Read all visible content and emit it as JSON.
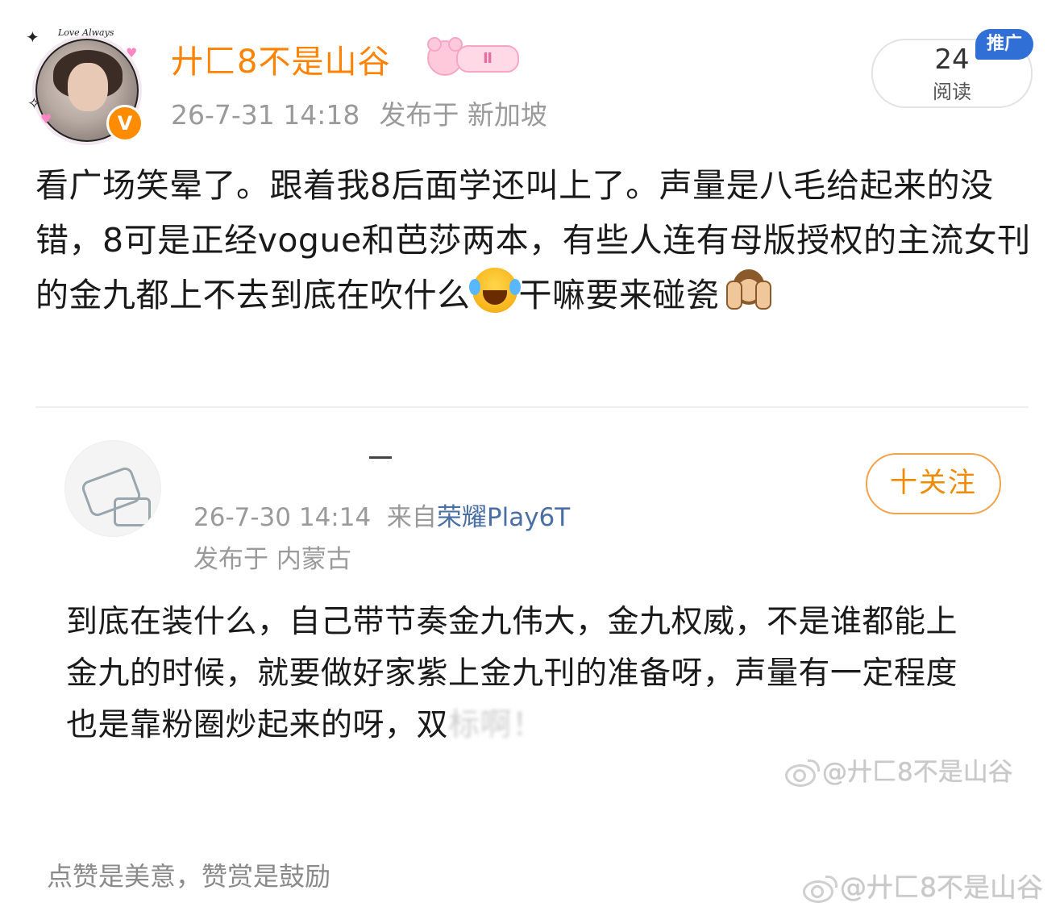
{
  "post": {
    "username": "廾匚8不是山谷",
    "badge_text": "Ⅱ",
    "verified_badge": "V",
    "date": "26-7-31 14:18",
    "location": "发布于 新加坡",
    "read_count": "24",
    "read_label": "阅读",
    "promo_tag": "推广",
    "text_part1": "看广场笑晕了。跟着我8后面学还叫上了。声量是八毛给起来的没错，8可是正经vogue和芭莎两本，有些人连有母版授权的主流女刊的金九都上不去到底在吹什么",
    "text_part2": "干嘛要来碰瓷",
    "emoji_1": "laughing-crying-emoji",
    "emoji_2": "see-no-evil-monkey-emoji"
  },
  "quoted": {
    "date_source": "26-7-30 14:14",
    "source_prefix": "来自",
    "device": "荣耀Play6T",
    "location": "发布于 内蒙古",
    "follow_label": "十关注",
    "text_main": "到底在装什么，自己带节奏金九伟大，金九权威，不是谁都能上金九的时候，就要做好家紫上金九刊的准备呀，声量有一定程度也是靠粉圈炒起来的呀，双",
    "text_blurred": "标",
    "text_end": "啊！"
  },
  "watermarks": {
    "wm1": "@廾匚8不是山谷",
    "wm2": "@廾匚8不是山谷"
  },
  "footer": {
    "note": "点赞是美意，赞赏是鼓励"
  },
  "colors": {
    "username": "#ff8200",
    "meta": "#9a9a9a",
    "follow": "#f08a00",
    "promo_bg": "#2f6fd6",
    "device_link": "#4a6fa5"
  }
}
